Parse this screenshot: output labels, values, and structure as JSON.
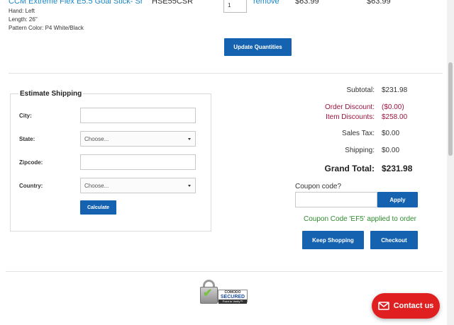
{
  "cart_item": {
    "name": "CCM Extreme Flex E5.5 Goal Stick- Sr",
    "options": [
      "Hand: Left",
      "Length: 26\"",
      "Pattern Color: P4 White/Black"
    ],
    "sku": "HSE55CSR",
    "quantity": "1",
    "remove_label": "remove",
    "unit_price": "$63.99",
    "line_total": "$63.99"
  },
  "update_button": "Update Quantities",
  "estimate_shipping": {
    "title": "Estimate Shipping",
    "city_label": "City:",
    "state_label": "State:",
    "state_value": "Choose...",
    "zip_label": "Zipcode:",
    "country_label": "Country:",
    "country_value": "Choose...",
    "calculate_button": "Calculate"
  },
  "totals": {
    "subtotal_label": "Subtotal:",
    "subtotal": "$231.98",
    "order_discount_label": "Order Discount:",
    "order_discount": "($0.00)",
    "item_discounts_label": "Item Discounts:",
    "item_discounts": "$258.00",
    "sales_tax_label": "Sales Tax:",
    "sales_tax": "$0.00",
    "shipping_label": "Shipping:",
    "shipping": "$0.00",
    "grand_total_label": "Grand Total:",
    "grand_total": "$231.98"
  },
  "coupon": {
    "label": "Coupon code?",
    "apply_button": "Apply",
    "message": "Coupon Code 'EF5' applied to order"
  },
  "actions": {
    "keep_shopping": "Keep Shopping",
    "checkout": "Checkout"
  },
  "badge": {
    "line1": "COMODO",
    "line2": "SECURED",
    "line3": "Point to Verify™"
  },
  "contact_button": "Contact us",
  "colors": {
    "primary_button": "#1462b0",
    "link": "#1a86c8",
    "discount": "#a0153e",
    "success": "#2e8b2e",
    "contact": "#e02020"
  }
}
